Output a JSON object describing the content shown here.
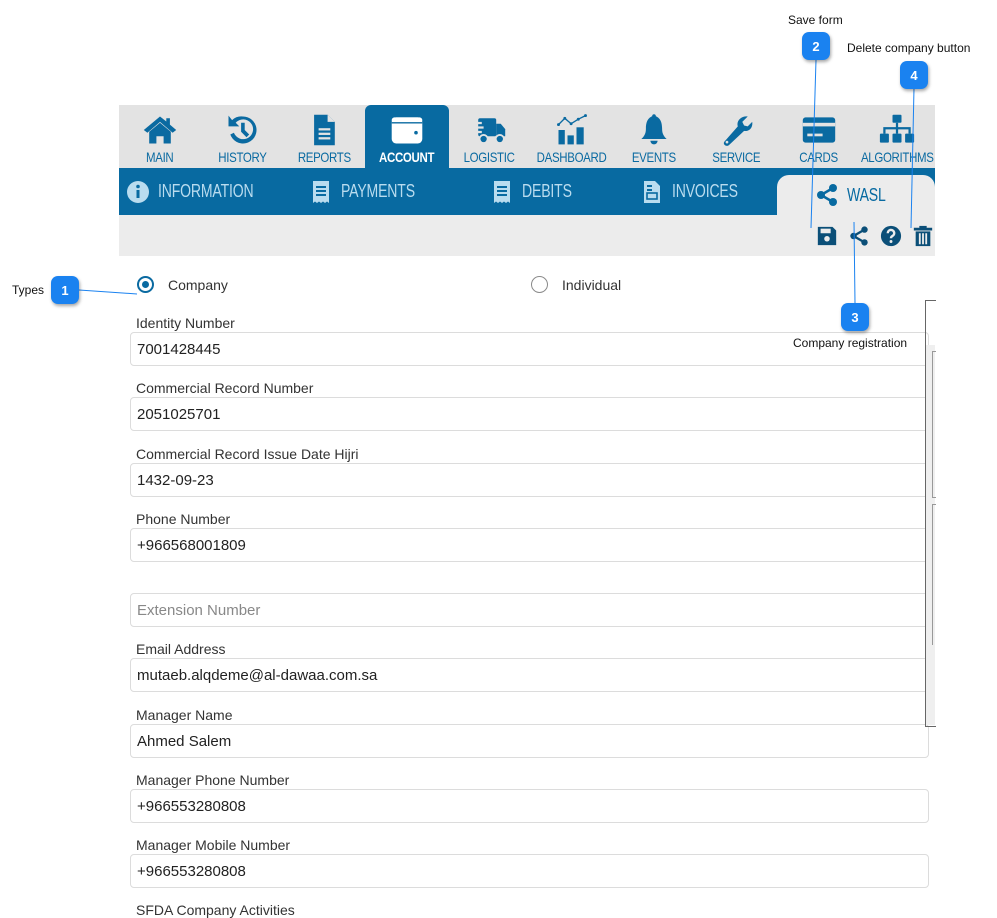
{
  "top_nav": {
    "items": [
      {
        "label": "MAIN",
        "icon": "home-icon"
      },
      {
        "label": "HISTORY",
        "icon": "history-icon"
      },
      {
        "label": "REPORTS",
        "icon": "document-icon"
      },
      {
        "label": "ACCOUNT",
        "icon": "wallet-icon",
        "active": true
      },
      {
        "label": "LOGISTIC",
        "icon": "truck-icon"
      },
      {
        "label": "DASHBOARD",
        "icon": "chart-icon"
      },
      {
        "label": "EVENTS",
        "icon": "bell-icon"
      },
      {
        "label": "SERVICE",
        "icon": "wrench-icon"
      },
      {
        "label": "CARDS",
        "icon": "credit-card-icon"
      },
      {
        "label": "ALGORITHMS",
        "icon": "sitemap-icon"
      }
    ]
  },
  "sub_nav": {
    "items": [
      {
        "label": "INFORMATION",
        "icon": "info-icon"
      },
      {
        "label": "PAYMENTS",
        "icon": "receipt-icon"
      },
      {
        "label": "DEBITS",
        "icon": "receipt-icon"
      },
      {
        "label": "INVOICES",
        "icon": "invoice-icon"
      },
      {
        "label": "WASL",
        "icon": "share-icon",
        "active": true
      }
    ]
  },
  "toolbar": {
    "buttons": [
      "save-icon",
      "share-icon",
      "help-icon",
      "trash-icon"
    ]
  },
  "types": {
    "options": [
      {
        "label": "Company",
        "checked": true
      },
      {
        "label": "Individual",
        "checked": false
      }
    ]
  },
  "form": {
    "fields": [
      {
        "label": "Identity Number",
        "value": "7001428445"
      },
      {
        "label": "Commercial Record Number",
        "value": "2051025701"
      },
      {
        "label": "Commercial Record Issue Date Hijri",
        "value": "1432-09-23"
      },
      {
        "label": "Phone Number",
        "value": "+966568001809"
      },
      {
        "label": "",
        "value": "",
        "placeholder": "Extension Number"
      },
      {
        "label": "Email Address",
        "value": "mutaeb.alqdeme@al-dawaa.com.sa"
      },
      {
        "label": "Manager Name",
        "value": "Ahmed Salem"
      },
      {
        "label": "Manager Phone Number",
        "value": "+966553280808"
      },
      {
        "label": "Manager Mobile Number",
        "value": "+966553280808"
      },
      {
        "label": "SFDA Company Activities",
        "value": ""
      }
    ]
  },
  "callouts": [
    {
      "number": "1",
      "text": "Types"
    },
    {
      "number": "2",
      "text": "Save form"
    },
    {
      "number": "3",
      "text": "Company registration"
    },
    {
      "number": "4",
      "text": "Delete company button"
    }
  ],
  "colors": {
    "primary": "#086aa1",
    "nav_bg": "#e3e3e3",
    "callout": "#1a82f0"
  }
}
